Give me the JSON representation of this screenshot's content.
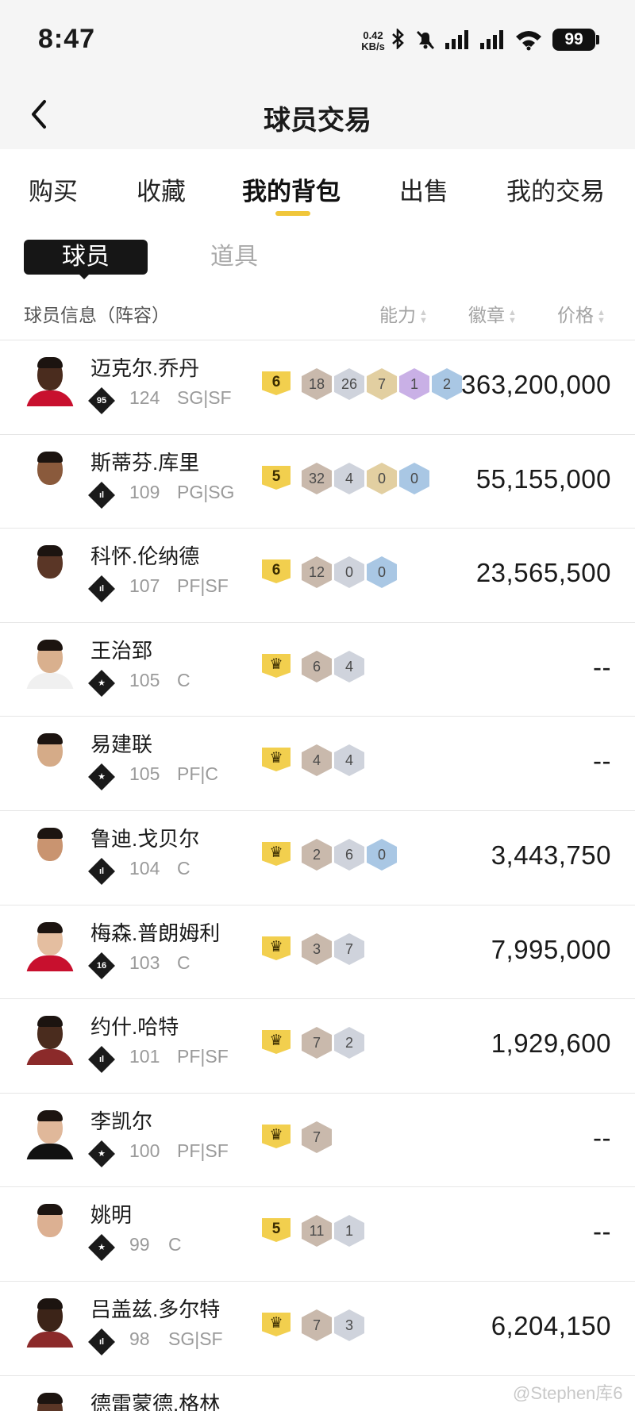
{
  "status_bar": {
    "time": "8:47",
    "net_speed_value": "0.42",
    "net_speed_unit": "KB/s",
    "battery": "99"
  },
  "nav": {
    "title": "球员交易"
  },
  "tabs": [
    {
      "label": "购买",
      "active": false
    },
    {
      "label": "收藏",
      "active": false
    },
    {
      "label": "我的背包",
      "active": true
    },
    {
      "label": "出售",
      "active": false
    },
    {
      "label": "我的交易",
      "active": false
    }
  ],
  "segments": {
    "players": "球员",
    "items": "道具"
  },
  "columns": {
    "info": "球员信息（阵容）",
    "ability": "能力",
    "badges": "徽章",
    "price": "价格"
  },
  "players": [
    {
      "name": "迈克尔.乔丹",
      "icon_text": "95",
      "rating": "124",
      "position": "SG|SF",
      "level": "6",
      "badges": [
        {
          "v": "18",
          "tier": "bronze"
        },
        {
          "v": "26",
          "tier": "silver"
        },
        {
          "v": "7",
          "tier": "gold"
        },
        {
          "v": "1",
          "tier": "purple"
        },
        {
          "v": "2",
          "tier": "blue"
        }
      ],
      "price": "363,200,000"
    },
    {
      "name": "斯蒂芬.库里",
      "icon_text": "ıl",
      "rating": "109",
      "position": "PG|SG",
      "level": "5",
      "badges": [
        {
          "v": "32",
          "tier": "bronze"
        },
        {
          "v": "4",
          "tier": "silver"
        },
        {
          "v": "0",
          "tier": "gold"
        },
        {
          "v": "0",
          "tier": "blue"
        }
      ],
      "price": "55,155,000"
    },
    {
      "name": "科怀.伦纳德",
      "icon_text": "ıl",
      "rating": "107",
      "position": "PF|SF",
      "level": "6",
      "badges": [
        {
          "v": "12",
          "tier": "bronze"
        },
        {
          "v": "0",
          "tier": "silver"
        },
        {
          "v": "0",
          "tier": "blue"
        }
      ],
      "price": "23,565,500"
    },
    {
      "name": "王治郅",
      "icon_text": "★",
      "rating": "105",
      "position": "C",
      "level": "♛",
      "badges": [
        {
          "v": "6",
          "tier": "bronze"
        },
        {
          "v": "4",
          "tier": "silver"
        }
      ],
      "price": "--"
    },
    {
      "name": "易建联",
      "icon_text": "★",
      "rating": "105",
      "position": "PF|C",
      "level": "♛",
      "badges": [
        {
          "v": "4",
          "tier": "bronze"
        },
        {
          "v": "4",
          "tier": "silver"
        }
      ],
      "price": "--"
    },
    {
      "name": "鲁迪.戈贝尔",
      "icon_text": "ıl",
      "rating": "104",
      "position": "C",
      "level": "♛",
      "badges": [
        {
          "v": "2",
          "tier": "bronze"
        },
        {
          "v": "6",
          "tier": "silver"
        },
        {
          "v": "0",
          "tier": "blue"
        }
      ],
      "price": "3,443,750"
    },
    {
      "name": "梅森.普朗姆利",
      "icon_text": "16",
      "rating": "103",
      "position": "C",
      "level": "♛",
      "badges": [
        {
          "v": "3",
          "tier": "bronze"
        },
        {
          "v": "7",
          "tier": "silver"
        }
      ],
      "price": "7,995,000"
    },
    {
      "name": "约什.哈特",
      "icon_text": "ıl",
      "rating": "101",
      "position": "PF|SF",
      "level": "♛",
      "badges": [
        {
          "v": "7",
          "tier": "bronze"
        },
        {
          "v": "2",
          "tier": "silver"
        }
      ],
      "price": "1,929,600"
    },
    {
      "name": "李凯尔",
      "icon_text": "★",
      "rating": "100",
      "position": "PF|SF",
      "level": "♛",
      "badges": [
        {
          "v": "7",
          "tier": "bronze"
        }
      ],
      "price": "--"
    },
    {
      "name": "姚明",
      "icon_text": "★",
      "rating": "99",
      "position": "C",
      "level": "5",
      "badges": [
        {
          "v": "11",
          "tier": "bronze"
        },
        {
          "v": "1",
          "tier": "silver"
        }
      ],
      "price": "--"
    },
    {
      "name": "吕盖兹.多尔特",
      "icon_text": "ıl",
      "rating": "98",
      "position": "SG|SF",
      "level": "♛",
      "badges": [
        {
          "v": "7",
          "tier": "bronze"
        },
        {
          "v": "3",
          "tier": "silver"
        }
      ],
      "price": "6,204,150"
    },
    {
      "name": "德雷蒙德.格林",
      "icon_text": "",
      "rating": "",
      "position": "",
      "level": "",
      "badges": [],
      "price": ""
    }
  ],
  "watermark": "@Stephen库6"
}
